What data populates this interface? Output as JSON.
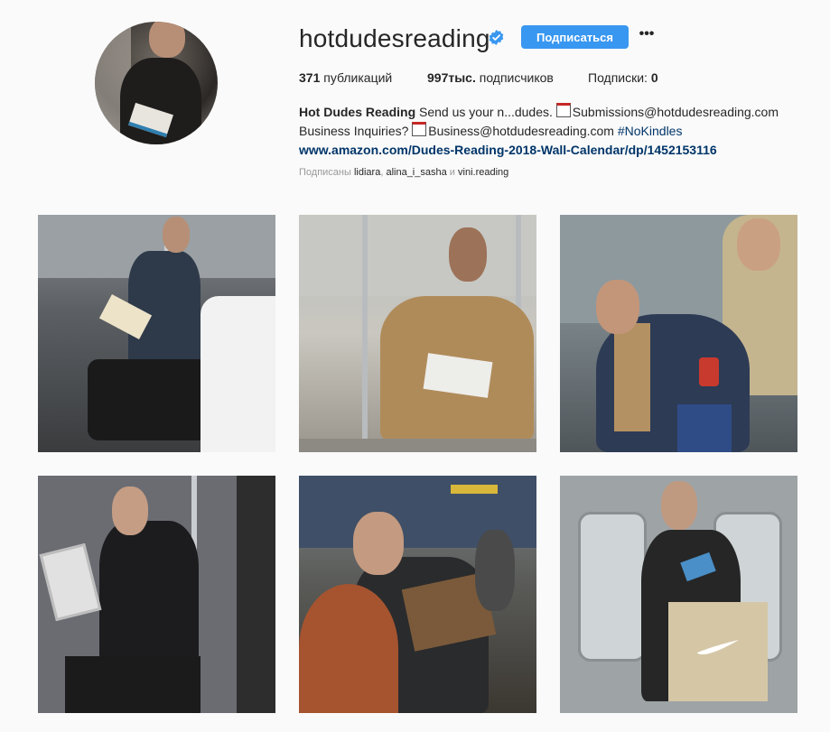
{
  "profile": {
    "username": "hotdudesreading",
    "follow_label": "Подписаться",
    "more_label": "•••",
    "colors": {
      "accent": "#3897f0",
      "verified": "#3897f0",
      "link": "#003569"
    }
  },
  "stats": {
    "posts_count": "371",
    "posts_label": "публикаций",
    "followers_count": "997тыс.",
    "followers_label": "подписчиков",
    "following_label": "Подписки:",
    "following_count": "0"
  },
  "bio": {
    "name": "Hot Dudes Reading",
    "text1": "Send us your n...dudes.",
    "submissions_email": "Submissions@hotdudesreading.com",
    "business_label": "Business Inquiries?",
    "business_email": "Business@hotdudesreading.com",
    "hashtag": "#NoKindles",
    "website": "www.amazon.com/Dudes-Reading-2018-Wall-Calendar/dp/1452153116"
  },
  "followed_by": {
    "prefix": "Подписаны",
    "users": [
      "lidiara",
      "alina_i_sasha",
      "vini.reading"
    ],
    "conjunction": "и"
  },
  "grid": {
    "photos": [
      {
        "description": "subway-reader-plaid"
      },
      {
        "description": "subway-reader-jacket"
      },
      {
        "description": "subway-reader-coffee"
      },
      {
        "description": "subway-reader-sunglasses"
      },
      {
        "description": "subway-reader-book"
      },
      {
        "description": "subway-reader-nike"
      }
    ]
  }
}
